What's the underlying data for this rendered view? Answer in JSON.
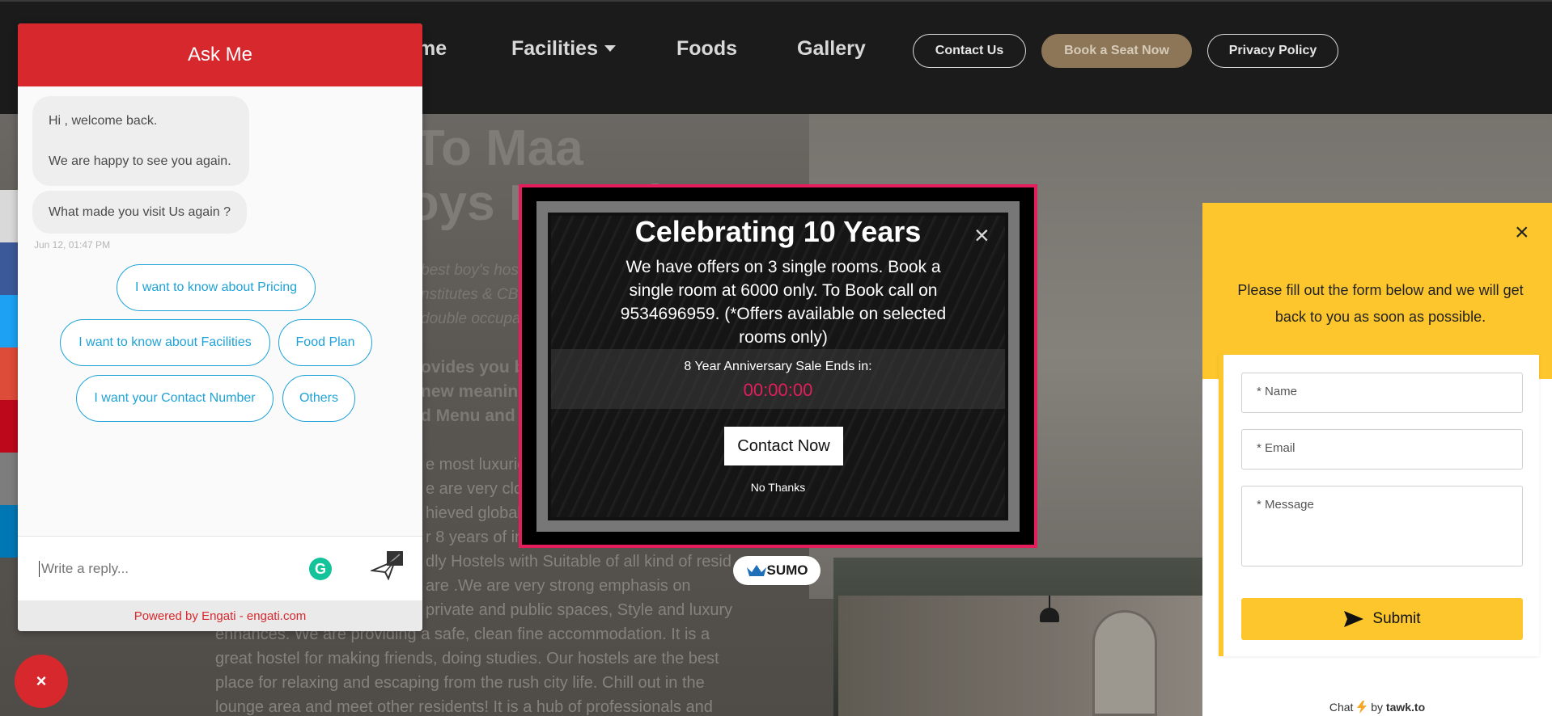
{
  "nav": {
    "home_partial": "me",
    "facilities": "Facilities",
    "foods": "Foods",
    "gallery": "Gallery",
    "contact_us": "Contact Us",
    "book_seat": "Book a Seat Now",
    "privacy": "Privacy Policy"
  },
  "hero": {
    "title_line1": "e To Maa",
    "title_line2": "Boys Hostel",
    "italic_line1": "best boy's hoste",
    "italic_line2": "nstitutes & CBSE",
    "italic_line3": "double occupancy",
    "bold_line1": "ovides you bes",
    "bold_line2": "new meaning o",
    "bold_line3": "d Menu and ma",
    "body": [
      "e most luxurious",
      "e are very close to",
      "hieved global st   ndards of product quality",
      "r 8 years of industry experience. Maa Gayatri",
      "dly Hostels with Suitable of all kind of resid",
      "are .We are very strong emphasis on",
      "private and public spaces, Style and luxury",
      "enhances. We are providing a safe, clean fine accommodation. It is a",
      "great hostel for making friends, doing studies. Our hostels are the best",
      "place for relaxing and escaping from the rush city life. Chill out in the",
      "lounge area and meet other residents! It is a hub of professionals and"
    ]
  },
  "chat": {
    "header": "Ask Me",
    "greeting_line1": "Hi , welcome back.",
    "greeting_line2": "We are happy to see you again.",
    "question": "What made you visit Us again ?",
    "timestamp": "Jun 12, 01:47 PM",
    "quick_replies": {
      "pricing": "I want to know about Pricing",
      "facilities": "I want to know about Facilities",
      "food": "Food Plan",
      "contact": "I want your Contact Number",
      "others": "Others"
    },
    "input_placeholder": "Write a reply...",
    "footer": "Powered by Engati - engati.com",
    "close_glyph": "×",
    "accent": "#d7282d"
  },
  "popup": {
    "title": "Celebrating 10 Years",
    "close_glyph": "×",
    "text": "We have offers on 3 single rooms. Book a single room at 6000 only. To Book call on 9534696959. (*Offers available on selected rooms only)",
    "countdown_label": "8 Year Anniversary Sale Ends in:",
    "countdown": "00:00:00",
    "cta": "Contact Now",
    "dismiss": "No Thanks",
    "badge": "SUMO",
    "accent": "#e41e5c"
  },
  "tawk": {
    "close_glyph": "×",
    "message": "Please fill out the form below and we will get back to you as soon as possible.",
    "name_placeholder": "* Name",
    "email_placeholder": "* Email",
    "message_placeholder": "* Message",
    "submit": "Submit",
    "brand_prefix": "Chat",
    "brand_by": "by",
    "brand_name": "tawk.to",
    "accent": "#fcc62c"
  }
}
